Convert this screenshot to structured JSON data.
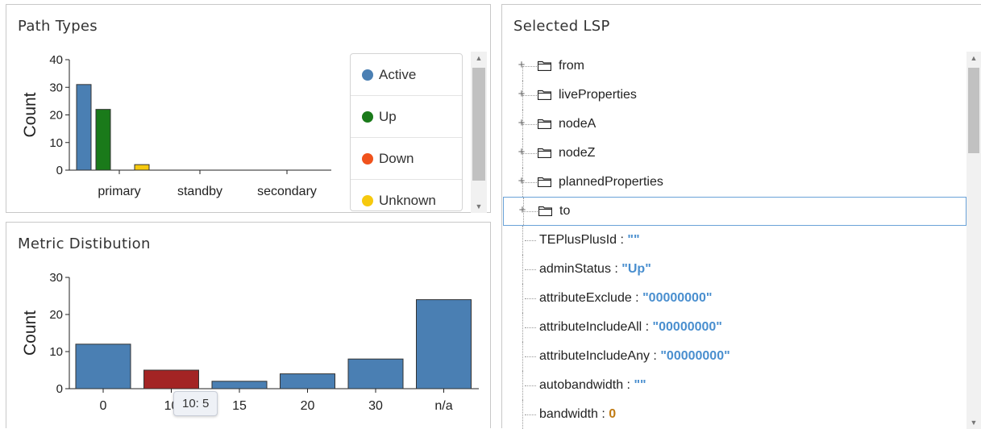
{
  "path_types": {
    "title": "Path Types",
    "legend": [
      {
        "label": "Active",
        "color": "#4a7fb3"
      },
      {
        "label": "Up",
        "color": "#1a7a1a"
      },
      {
        "label": "Down",
        "color": "#f0521c"
      },
      {
        "label": "Unknown",
        "color": "#f6c90e"
      }
    ]
  },
  "metric": {
    "title": "Metric Distibution",
    "tooltip": "10: 5"
  },
  "lsp": {
    "title": "Selected LSP",
    "folders": [
      {
        "label": "from"
      },
      {
        "label": "liveProperties"
      },
      {
        "label": "nodeA"
      },
      {
        "label": "nodeZ"
      },
      {
        "label": "plannedProperties"
      },
      {
        "label": "to"
      }
    ],
    "properties": [
      {
        "key": "TEPlusPlusId",
        "sep": " : ",
        "value": "\"\"",
        "kind": "str"
      },
      {
        "key": "adminStatus",
        "sep": " : ",
        "value": "\"Up\"",
        "kind": "str"
      },
      {
        "key": "attributeExclude",
        "sep": " : ",
        "value": "\"00000000\"",
        "kind": "str"
      },
      {
        "key": "attributeIncludeAll",
        "sep": " : ",
        "value": "\"00000000\"",
        "kind": "str"
      },
      {
        "key": "attributeIncludeAny",
        "sep": " : ",
        "value": "\"00000000\"",
        "kind": "str"
      },
      {
        "key": "autobandwidth",
        "sep": " : ",
        "value": "\"\"",
        "kind": "str"
      },
      {
        "key": "bandwidth",
        "sep": " : ",
        "value": "0",
        "kind": "num"
      }
    ]
  },
  "chart_data": [
    {
      "type": "bar",
      "title": "Path Types",
      "ylabel": "Count",
      "ylim": [
        0,
        40
      ],
      "yticks": [
        "0",
        "10",
        "20",
        "30",
        "40"
      ],
      "categories": [
        "primary",
        "standby",
        "secondary"
      ],
      "series": [
        {
          "name": "Active",
          "color": "#4a7fb3",
          "values": [
            31,
            0,
            0
          ]
        },
        {
          "name": "Up",
          "color": "#1a7a1a",
          "values": [
            22,
            0,
            0
          ]
        },
        {
          "name": "Down",
          "color": "#f0521c",
          "values": [
            0,
            0,
            0
          ]
        },
        {
          "name": "Unknown",
          "color": "#f6c90e",
          "values": [
            2,
            0,
            0
          ]
        }
      ],
      "legend": "right"
    },
    {
      "type": "bar",
      "title": "Metric Distibution",
      "ylabel": "Count",
      "ylim": [
        0,
        30
      ],
      "yticks": [
        "0",
        "10",
        "20",
        "30"
      ],
      "categories": [
        "0",
        "10",
        "15",
        "20",
        "30",
        "n/a"
      ],
      "values": [
        12,
        5,
        2,
        4,
        8,
        24
      ],
      "bar_color": "#4a7fb3",
      "highlight": {
        "index": 1,
        "color": "#a32424"
      }
    }
  ]
}
